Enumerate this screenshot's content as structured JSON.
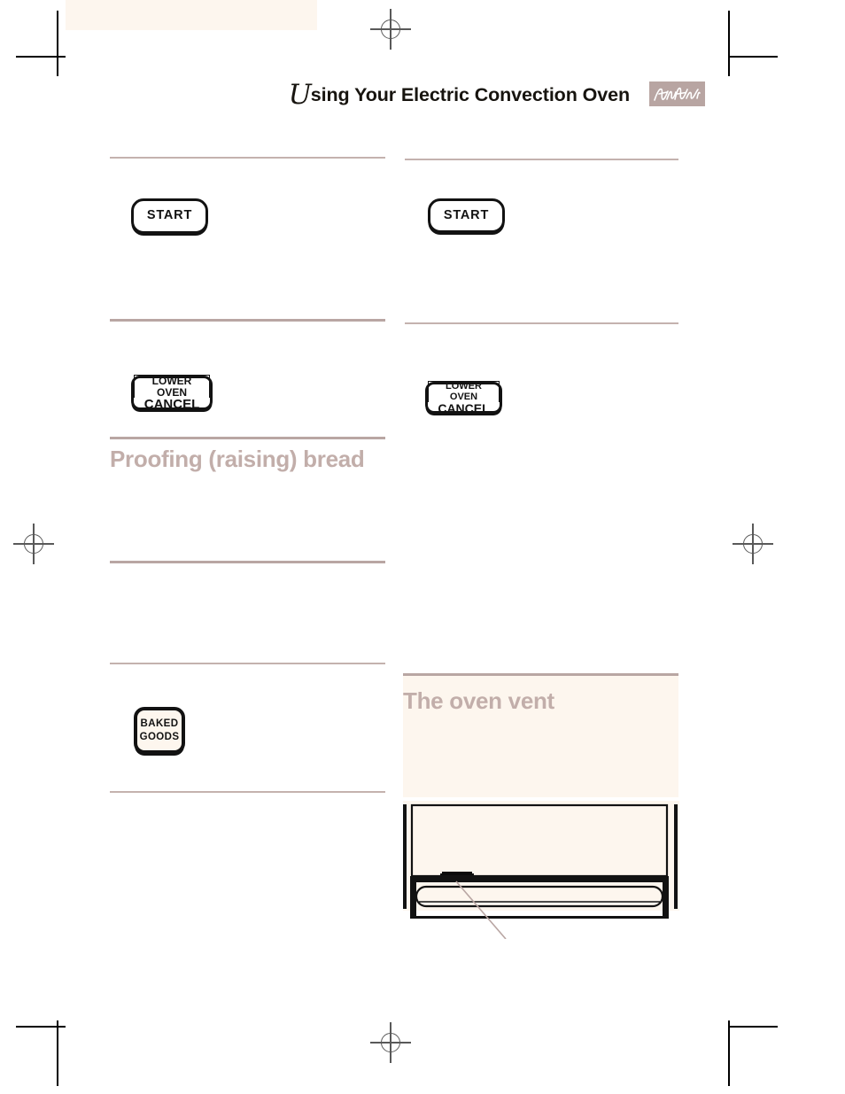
{
  "document": {
    "type": "appliance-manual-page",
    "page_background": "#ffffff",
    "accent_color": "#b9a6a3",
    "heading_color": "#c2aeaa",
    "panel_cream": "#fdf6ee",
    "line_art_black": "#121212"
  },
  "header": {
    "title_dropcap": "U",
    "title_rest": "sing Your Electric Convection Oven",
    "title_full": "Using Your Electric Convection Oven",
    "signature_name": "signature-mark",
    "signature_box_color": "#b8a5a2"
  },
  "left_column": {
    "rules": [
      {
        "name": "rule-top",
        "style": "thin"
      },
      {
        "name": "rule-below-start",
        "style": "thick"
      },
      {
        "name": "rule-above-proofing",
        "style": "thick"
      },
      {
        "name": "rule-mid",
        "style": "thick"
      },
      {
        "name": "rule-above-baked-goods",
        "style": "thin"
      },
      {
        "name": "rule-bottom",
        "style": "thin"
      }
    ],
    "start_button": {
      "label": "START"
    },
    "lower_oven_button": {
      "line_1": "LOWER OVEN",
      "line_2": "CANCEL"
    },
    "proofing_heading": "Proofing (raising) bread",
    "baked_goods_button": {
      "line_1": "BAKED",
      "line_2": "GOODS"
    }
  },
  "right_column": {
    "rules": [
      {
        "name": "rule-top",
        "style": "thin"
      },
      {
        "name": "rule-below-start",
        "style": "thin"
      }
    ],
    "start_button": {
      "label": "START"
    },
    "lower_oven_button": {
      "line_1": "LOWER OVEN",
      "line_2": "CANCEL"
    },
    "vent_section": {
      "heading": "The oven vent",
      "illustration_name": "oven-vent-diagram",
      "illustration_caption": ""
    }
  },
  "print_marks": {
    "registration_marks": 4,
    "crop_marks": 8,
    "bleed_band_color": "#fdf6ee"
  }
}
